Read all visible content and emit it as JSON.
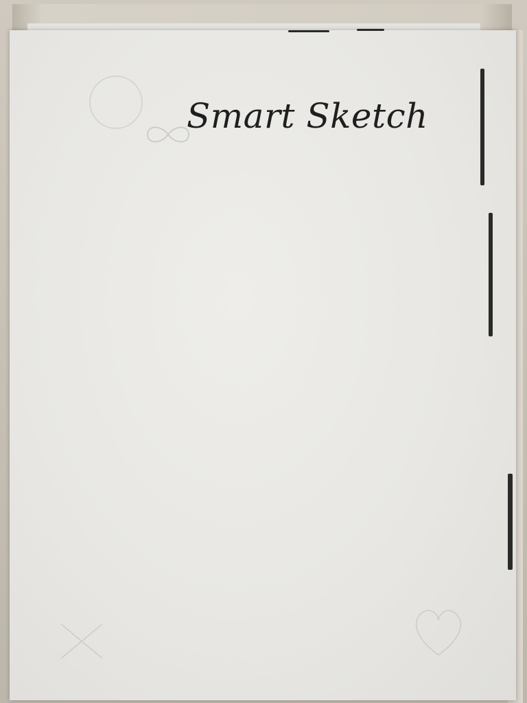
{
  "photo": {
    "handwritten_title": "Smart Sketch",
    "faint_symbol": "infinity-icon"
  },
  "colors": {
    "paper": "#e9e8e4",
    "ink": "#1f1f1f",
    "tray": "#cfc9bf",
    "background": "#3a3a40"
  }
}
